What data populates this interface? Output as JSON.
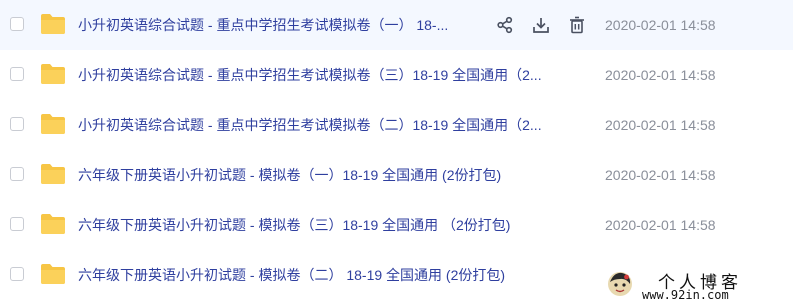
{
  "files": [
    {
      "name": "小升初英语综合试题 - 重点中学招生考试模拟卷（一） 18-...",
      "date": "2020-02-01 14:58",
      "hovered": true
    },
    {
      "name": "小升初英语综合试题 - 重点中学招生考试模拟卷（三）18-19 全国通用（2...",
      "date": "2020-02-01 14:58",
      "hovered": false
    },
    {
      "name": "小升初英语综合试题 - 重点中学招生考试模拟卷（二）18-19 全国通用（2...",
      "date": "2020-02-01 14:58",
      "hovered": false
    },
    {
      "name": "六年级下册英语小升初试题 - 模拟卷（一）18-19 全国通用 (2份打包)",
      "date": "2020-02-01 14:58",
      "hovered": false
    },
    {
      "name": "六年级下册英语小升初试题 - 模拟卷（三）18-19 全国通用 （2份打包)",
      "date": "2020-02-01 14:58",
      "hovered": false
    },
    {
      "name": "六年级下册英语小升初试题 - 模拟卷（二） 18-19 全国通用 (2份打包)",
      "date": "2020-02-01 14:58",
      "hovered": false
    }
  ],
  "row_actions": [
    "share-icon",
    "download-icon",
    "delete-icon"
  ],
  "colors": {
    "folder": "#f7c544",
    "name": "#2f3f9f",
    "date": "#8a8f9a",
    "icon": "#4a5161"
  },
  "watermark": {
    "title": "个人博客",
    "url": "www.92in.com"
  }
}
